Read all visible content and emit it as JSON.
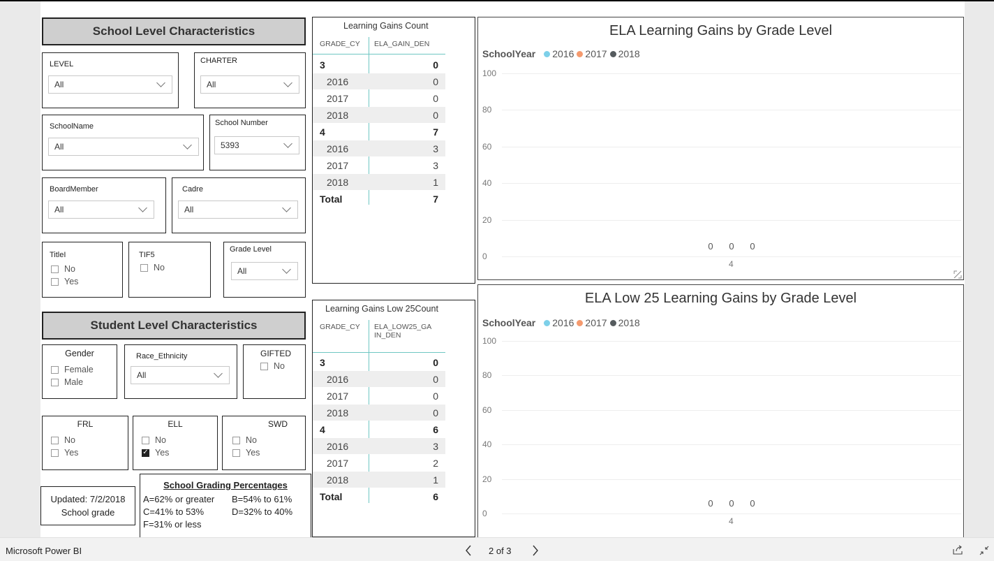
{
  "school_section": {
    "title": "School Level Characteristics",
    "level": {
      "label": "LEVEL",
      "value": "All"
    },
    "charter": {
      "label": "CHARTER",
      "value": "All"
    },
    "school_name": {
      "label": "SchoolName",
      "value": "All"
    },
    "school_number": {
      "label": "School Number",
      "value": "5393"
    },
    "board_member": {
      "label": "BoardMember",
      "value": "All"
    },
    "cadre": {
      "label": "Cadre",
      "value": "All"
    },
    "titlei": {
      "label": "TitleI",
      "options": [
        "No",
        "Yes"
      ]
    },
    "tif5": {
      "label": "TIF5",
      "options": [
        "No"
      ]
    },
    "grade_level": {
      "label": "Grade Level",
      "value": "All"
    }
  },
  "student_section": {
    "title": "Student Level Characteristics",
    "gender": {
      "label": "Gender",
      "options": [
        "Female",
        "Male"
      ]
    },
    "race": {
      "label": "Race_Ethnicity",
      "value": "All"
    },
    "gifted": {
      "label": "GIFTED",
      "options": [
        "No"
      ]
    },
    "frl": {
      "label": "FRL",
      "options": [
        "No",
        "Yes"
      ]
    },
    "ell": {
      "label": "ELL",
      "options": [
        "No",
        "Yes"
      ],
      "checked": "Yes"
    },
    "swd": {
      "label": "SWD",
      "options": [
        "No",
        "Yes"
      ]
    }
  },
  "updated": {
    "line1": "Updated: 7/2/2018",
    "line2": "School grade"
  },
  "grading": {
    "title": "School Grading Percentages",
    "a": "A=62% or greater",
    "b": "B=54% to 61%",
    "c": "C=41% to 53%",
    "d": "D=32% to 40%",
    "f": "F=31% or less"
  },
  "table1": {
    "title": "Learning Gains Count",
    "headers": [
      "GRADE_CY",
      "ELA_GAIN_DEN"
    ],
    "rows": [
      {
        "label": "3",
        "value": "0",
        "kind": "group"
      },
      {
        "label": "2016",
        "value": "0",
        "kind": "alt"
      },
      {
        "label": "2017",
        "value": "0",
        "kind": "plain"
      },
      {
        "label": "2018",
        "value": "0",
        "kind": "alt"
      },
      {
        "label": "4",
        "value": "7",
        "kind": "group"
      },
      {
        "label": "2016",
        "value": "3",
        "kind": "alt"
      },
      {
        "label": "2017",
        "value": "3",
        "kind": "plain"
      },
      {
        "label": "2018",
        "value": "1",
        "kind": "alt"
      },
      {
        "label": "Total",
        "value": "7",
        "kind": "group"
      }
    ]
  },
  "table2": {
    "title": "Learning Gains Low 25Count",
    "headers": [
      "GRADE_CY",
      "ELA_LOW25_GA IN_DEN"
    ],
    "rows": [
      {
        "label": "3",
        "value": "0",
        "kind": "group"
      },
      {
        "label": "2016",
        "value": "0",
        "kind": "alt"
      },
      {
        "label": "2017",
        "value": "0",
        "kind": "plain"
      },
      {
        "label": "2018",
        "value": "0",
        "kind": "alt"
      },
      {
        "label": "4",
        "value": "6",
        "kind": "group"
      },
      {
        "label": "2016",
        "value": "3",
        "kind": "alt"
      },
      {
        "label": "2017",
        "value": "2",
        "kind": "plain"
      },
      {
        "label": "2018",
        "value": "1",
        "kind": "alt"
      },
      {
        "label": "Total",
        "value": "6",
        "kind": "group"
      }
    ]
  },
  "legend_colors": {
    "2016": "#7dd0e9",
    "2017": "#f59a6e",
    "2018": "#555b5e"
  },
  "chart_data": [
    {
      "type": "bar",
      "title": "ELA Learning Gains by Grade Level",
      "legend_title": "SchoolYear",
      "legend_position": "top-left",
      "categories": [
        "4"
      ],
      "series": [
        {
          "name": "2016",
          "values": [
            0
          ]
        },
        {
          "name": "2017",
          "values": [
            0
          ]
        },
        {
          "name": "2018",
          "values": [
            0
          ]
        }
      ],
      "ylim": [
        0,
        100
      ],
      "yticks": [
        "0",
        "20",
        "40",
        "60",
        "80",
        "100"
      ],
      "grid": true
    },
    {
      "type": "bar",
      "title": "ELA Low 25 Learning Gains by Grade Level",
      "legend_title": "SchoolYear",
      "legend_position": "top-left",
      "categories": [
        "4"
      ],
      "series": [
        {
          "name": "2016",
          "values": [
            0
          ]
        },
        {
          "name": "2017",
          "values": [
            0
          ]
        },
        {
          "name": "2018",
          "values": [
            0
          ]
        }
      ],
      "ylim": [
        0,
        100
      ],
      "yticks": [
        "0",
        "20",
        "40",
        "60",
        "80",
        "100"
      ],
      "grid": true
    }
  ],
  "statusbar": {
    "app_name": "Microsoft Power BI",
    "page_indicator": "2 of 3",
    "prev_icon": "chevron-left-icon",
    "next_icon": "chevron-right-icon",
    "share_icon": "share-icon",
    "fullscreen_icon": "exit-fullscreen-icon"
  }
}
